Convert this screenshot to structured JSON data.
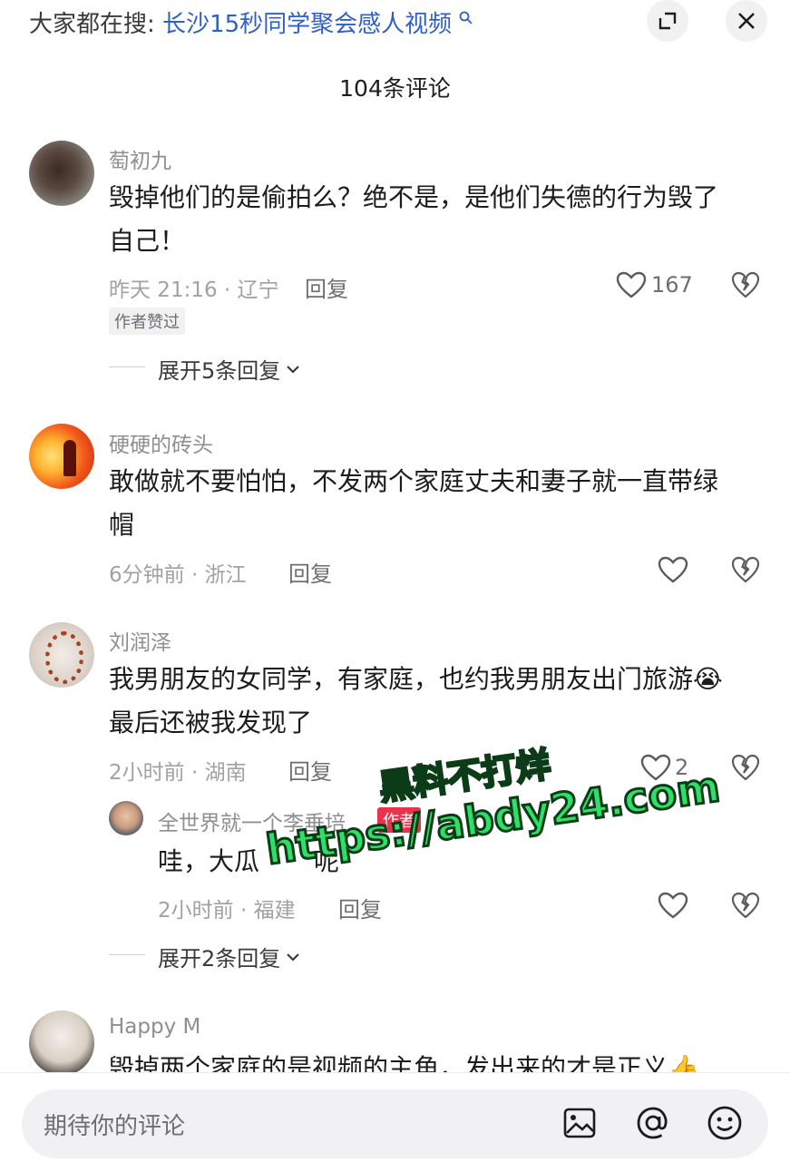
{
  "search_bar": {
    "prefix": "大家都在搜:",
    "term": "长沙15秒同学聚会感人视频",
    "search_icon": "search-icon",
    "expand_icon": "expand-icon",
    "close_icon": "close-icon"
  },
  "comment_count": "104条评论",
  "comments": [
    {
      "name": "萄初九",
      "text_line1": "毁掉他们的是偷拍么？绝不是，是他们失德的行为毁了",
      "text_line2": "自己！",
      "meta": "昨天 21:16 · 辽宁",
      "reply_label": "回复",
      "likes": "167",
      "liked_badge": "作者赞过",
      "expand_label": "展开5条回复"
    },
    {
      "name": "硬硬的砖头",
      "text_line1": "敢做就不要怕怕，不发两个家庭丈夫和妻子就一直带绿",
      "text_line2": "帽",
      "meta": "6分钟前 · 浙江",
      "reply_label": "回复"
    },
    {
      "name": "刘润泽",
      "text_line1": "我男朋友的女同学，有家庭，也约我男朋友出门旅游😭",
      "text_line2": "最后还被我发现了",
      "meta": "2小时前 · 湖南",
      "reply_label": "回复",
      "likes": "2",
      "sub_reply": {
        "name": "全世界就一个李垂培",
        "author_badge": "作者",
        "text": "哇，大瓜",
        "text_tail": "呢",
        "meta": "2小时前 · 福建",
        "reply_label": "回复"
      },
      "expand_label": "展开2条回复"
    },
    {
      "name": "Happy M",
      "text_line1": "毁掉两个家庭的是视频的主角，发出来的才是正义👍"
    }
  ],
  "input": {
    "placeholder": "期待你的评论",
    "image_icon": "image-icon",
    "mention_icon": "at-icon",
    "emoji_icon": "emoji-icon"
  },
  "watermark": {
    "line1": "黑料不打烊",
    "line2": "https://abdy24.com"
  },
  "colors": {
    "accent_link": "#2f5fc9",
    "author_badge": "#e8334a",
    "watermark_green": "#2ee06a"
  }
}
